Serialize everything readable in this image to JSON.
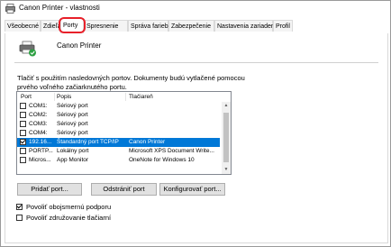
{
  "window": {
    "title": "Canon Printer - vlastnosti"
  },
  "tabs": [
    {
      "label": "Všeobecné"
    },
    {
      "label": "Zdieľanie"
    },
    {
      "label": "Porty"
    },
    {
      "label": "Spresnenie"
    },
    {
      "label": "Správa farieb"
    },
    {
      "label": "Zabezpečenie"
    },
    {
      "label": "Nastavenia zariadenia"
    },
    {
      "label": "Profil"
    }
  ],
  "active_tab": "Porty",
  "printer": {
    "name": "Canon Printer"
  },
  "description": "Tlačiť s použitím nasledovných portov. Dokumenty budú vytlačené pomocou prvého voľného začiarknutého portu.",
  "port_list": {
    "columns": [
      "Port",
      "Popis",
      "Tlačiareň"
    ],
    "rows": [
      {
        "port": "COM1:",
        "desc": "Sériový port",
        "printer": "",
        "checked": false,
        "selected": false
      },
      {
        "port": "COM2:",
        "desc": "Sériový port",
        "printer": "",
        "checked": false,
        "selected": false
      },
      {
        "port": "COM3:",
        "desc": "Sériový port",
        "printer": "",
        "checked": false,
        "selected": false
      },
      {
        "port": "COM4:",
        "desc": "Sériový port",
        "printer": "",
        "checked": false,
        "selected": false
      },
      {
        "port": "192.16...",
        "desc": "Štandardný port TCP/IP",
        "printer": "Canon Printer",
        "checked": true,
        "selected": true
      },
      {
        "port": "PORTP...",
        "desc": "Lokálny port",
        "printer": "Microsoft XPS Document Write...",
        "checked": false,
        "selected": false
      },
      {
        "port": "Micros...",
        "desc": "App Monitor",
        "printer": "OneNote for Windows 10",
        "checked": false,
        "selected": false
      }
    ]
  },
  "buttons": {
    "add_port": "Pridať port...",
    "delete_port": "Odstrániť port",
    "configure_port": "Konfigurovať port..."
  },
  "options": {
    "bidirectional": {
      "label": "Povoliť obojsmernú podporu",
      "checked": true
    },
    "pooling": {
      "label": "Povoliť združovanie tlačiarní",
      "checked": false
    }
  },
  "colors": {
    "selection": "#0078d7",
    "highlight_ring": "#e8202a"
  }
}
